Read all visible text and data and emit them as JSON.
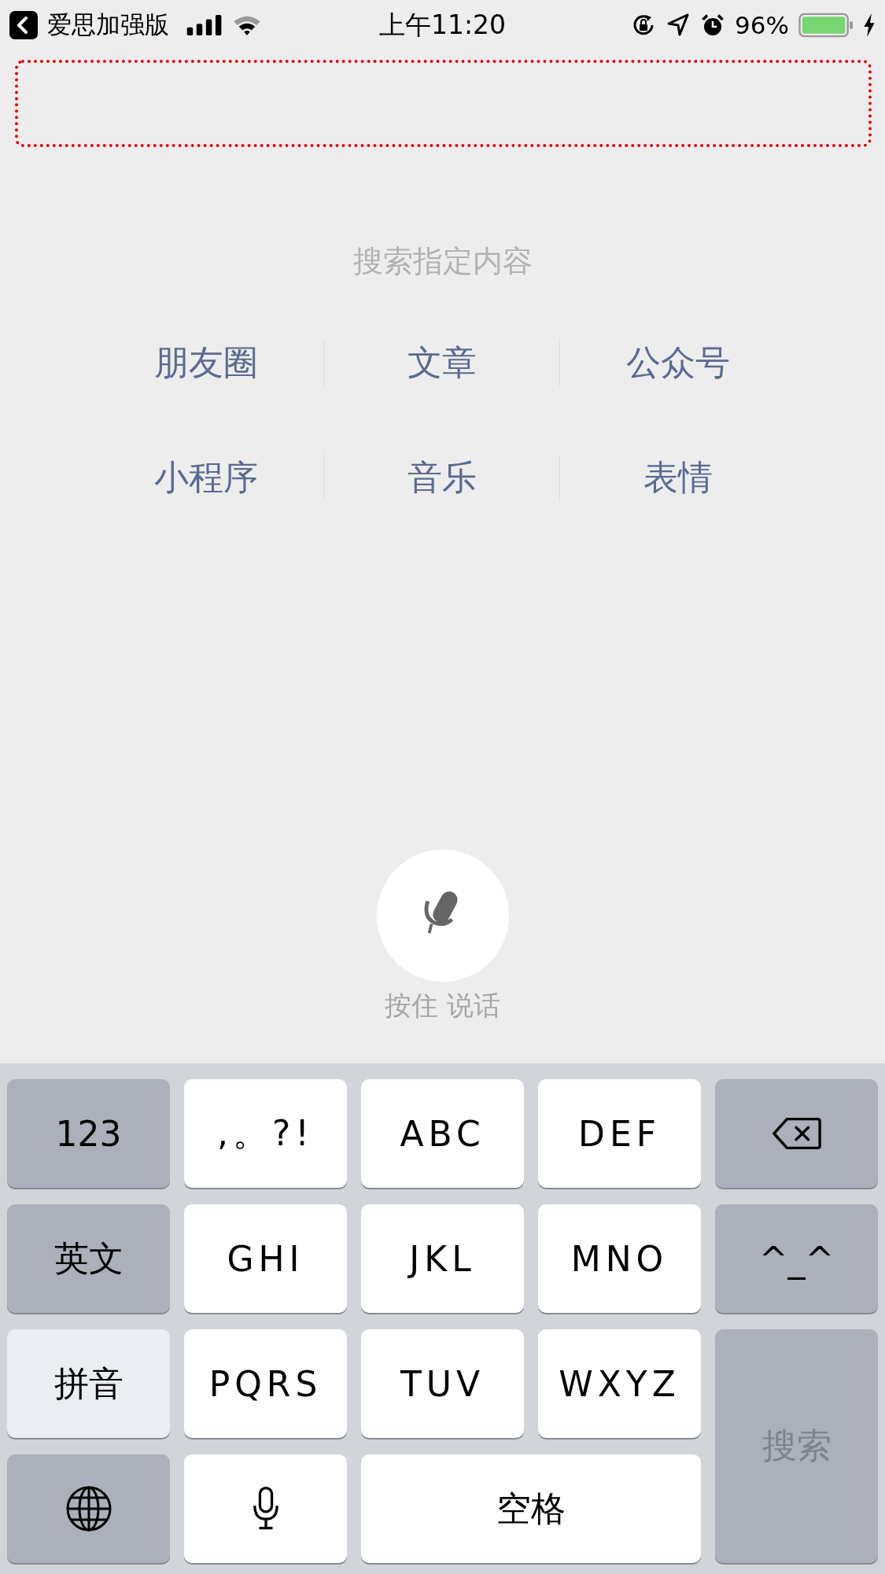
{
  "status_bar": {
    "back_label": "爱思加强版",
    "time": "上午11:20",
    "battery": "96%"
  },
  "search_hint": "搜索指定内容",
  "categories": [
    {
      "label": "朋友圈"
    },
    {
      "label": "文章"
    },
    {
      "label": "公众号"
    },
    {
      "label": "小程序"
    },
    {
      "label": "音乐"
    },
    {
      "label": "表情"
    }
  ],
  "voice": {
    "label": "按住 说话"
  },
  "keyboard": {
    "keys": [
      {
        "kind": "function",
        "label": "123"
      },
      {
        "kind": "letter",
        "label": ",。?!"
      },
      {
        "kind": "letter",
        "label": "ABC"
      },
      {
        "kind": "letter",
        "label": "DEF"
      },
      {
        "kind": "backspace"
      },
      {
        "kind": "mode",
        "label": "英文",
        "selected": false
      },
      {
        "kind": "letter",
        "label": "GHI"
      },
      {
        "kind": "letter",
        "label": "JKL"
      },
      {
        "kind": "letter",
        "label": "MNO"
      },
      {
        "kind": "function",
        "label": "^_^"
      },
      {
        "kind": "mode",
        "label": "拼音",
        "selected": true
      },
      {
        "kind": "letter",
        "label": "PQRS"
      },
      {
        "kind": "letter",
        "label": "TUV"
      },
      {
        "kind": "letter",
        "label": "WXYZ"
      },
      {
        "kind": "search",
        "label": "搜索",
        "disabled": true
      },
      {
        "kind": "globe"
      },
      {
        "kind": "mic"
      },
      {
        "kind": "space",
        "label": "空格"
      }
    ]
  }
}
